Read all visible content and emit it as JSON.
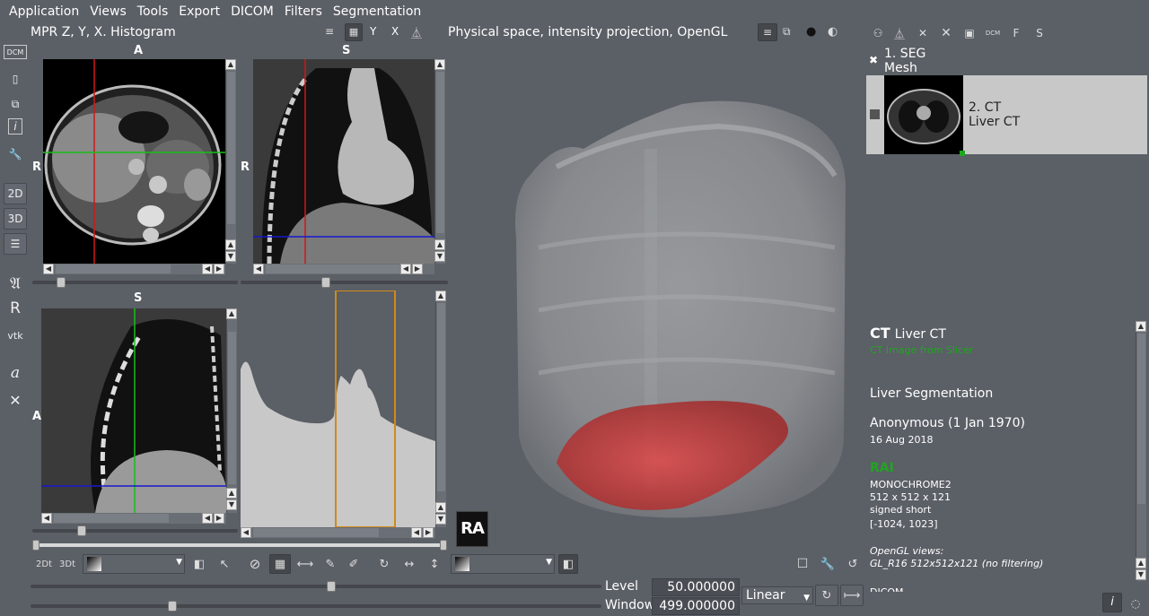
{
  "menu": [
    "Application",
    "Views",
    "Tools",
    "Export",
    "DICOM",
    "Filters",
    "Segmentation"
  ],
  "mpr_title": "MPR Z, Y, X. Histogram",
  "mpr_toolbar": {
    "y": "Y",
    "x": "X"
  },
  "view3d_title": "Physical space, intensity projection, OpenGL",
  "left_toolbar": {
    "dcm": "DCM",
    "info": "i",
    "t2d": "2D",
    "t3d": "3D",
    "font": "𝔄",
    "r": "R",
    "vtk": "vtk",
    "a": "a",
    "x": "✕"
  },
  "axial": {
    "top": "A",
    "left": "R"
  },
  "coronal": {
    "top": "S",
    "left": "R"
  },
  "sagittal": {
    "top": "S",
    "left": "A"
  },
  "orientation_cube": "RA",
  "series": [
    {
      "num": "1. SEG",
      "desc": "Mesh"
    },
    {
      "num": "2. CT",
      "desc": "Liver CT"
    }
  ],
  "right_toolbar": {
    "dcm": "DCM",
    "f": "F",
    "s": "S"
  },
  "info": {
    "modality": "CT",
    "series_desc": "Liver CT",
    "subtitle": "CT Image from Slicer",
    "study": "Liver Segmentation",
    "patient": "Anonymous (1 Jan 1970)",
    "date": "16 Aug 2018",
    "orient": "RAI",
    "photometric": "MONOCHROME2",
    "dims": "512 x 512 x 121",
    "type": "signed short",
    "range": "[-1024, 1023]",
    "opengl_label": "OpenGL views:",
    "opengl_value": "GL_R16 512x512x121 (no filtering)",
    "more": "DICOM ..."
  },
  "bottom": {
    "b2d": "2Dt",
    "b3d": "3Dt",
    "level_label": "Level",
    "level_value": "50.000000",
    "window_label": "Window",
    "window_value": "499.000000",
    "interp": "Linear",
    "info_btn": "i"
  },
  "colors": {
    "bg": "#5b5f66",
    "accent_window": "#d08a1a",
    "liver": "#c83030",
    "crosshair_red": "#d01818",
    "crosshair_green": "#18c018",
    "crosshair_blue": "#1818d0",
    "status_green": "#1fa61f"
  }
}
